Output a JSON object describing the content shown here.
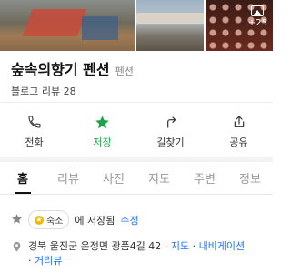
{
  "photos": {
    "more_count": "+25",
    "watermark": "naver"
  },
  "place": {
    "name": "숲속의향기 펜션",
    "category": "펜션",
    "review": "블로그 리뷰 28"
  },
  "actions": [
    {
      "label": "전화",
      "icon": "phone-icon"
    },
    {
      "label": "저장",
      "icon": "star-icon"
    },
    {
      "label": "길찾기",
      "icon": "directions-icon"
    },
    {
      "label": "공유",
      "icon": "share-icon"
    }
  ],
  "tabs": [
    "홈",
    "리뷰",
    "사진",
    "지도",
    "주변",
    "정보"
  ],
  "saved": {
    "chip": "숙소",
    "text": "에 저장됨",
    "edit": "수정"
  },
  "address": {
    "text": "경북 울진군 온정면 광품4길 42",
    "links": [
      "지도",
      "내비게이션",
      "거리뷰"
    ]
  },
  "colors": {
    "accent_green": "#1aa34a",
    "link_blue": "#1e73ff"
  }
}
